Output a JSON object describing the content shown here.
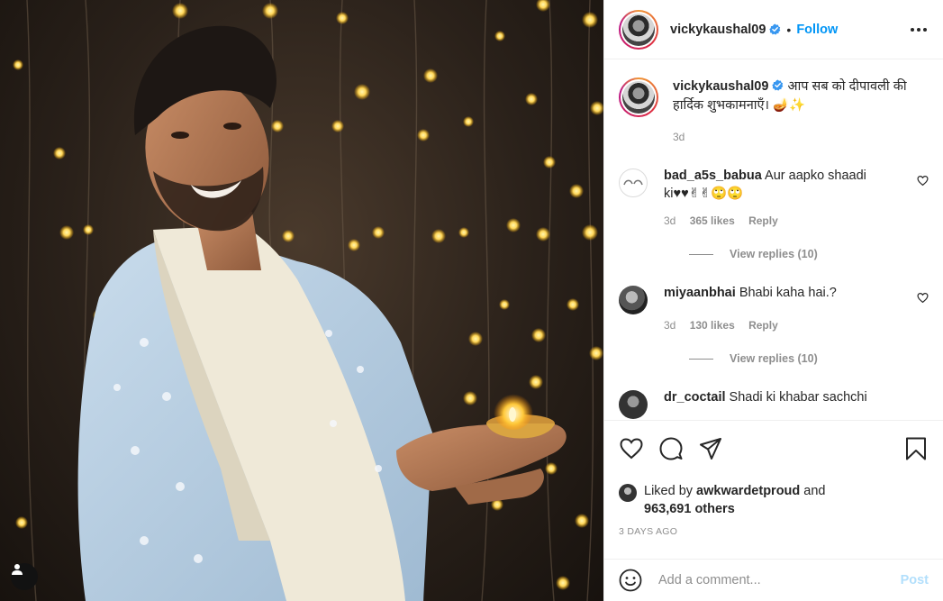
{
  "post": {
    "username": "vickykaushal09",
    "follow_label": "Follow",
    "separator": "•"
  },
  "caption": {
    "username": "vickykaushal09",
    "text": "आप सब को दीपावली की हार्दिक शुभकामनाएँ। 🪔✨",
    "age": "3d"
  },
  "comments": [
    {
      "username": "bad_a5s_babua",
      "text": "Aur aapko shaadi ki♥♥✌✌🙄🙄",
      "age": "3d",
      "likes": "365 likes",
      "reply_label": "Reply",
      "view_replies": "View replies (10)"
    },
    {
      "username": "miyaanbhai",
      "text": "Bhabi kaha hai.?",
      "age": "3d",
      "likes": "130 likes",
      "reply_label": "Reply",
      "view_replies": "View replies (10)"
    },
    {
      "username": "dr_coctail",
      "text": "Shadi ki khabar sachchi"
    }
  ],
  "likes_summary": {
    "prefix": "Liked by",
    "liker": "awkwardetproud",
    "and": "and",
    "others": "963,691 others"
  },
  "timestamp": "3 days ago",
  "add_comment": {
    "placeholder": "Add a comment...",
    "post_label": "Post"
  },
  "colors": {
    "accent": "#0095f6",
    "muted": "#8e8e8e",
    "post_disabled": "#b2dffc"
  },
  "icons": [
    "tag-user-icon",
    "verified-badge-icon",
    "more-options-icon",
    "heart-icon",
    "comment-icon",
    "share-icon",
    "save-icon",
    "emoji-icon",
    "like-comment-icon"
  ]
}
